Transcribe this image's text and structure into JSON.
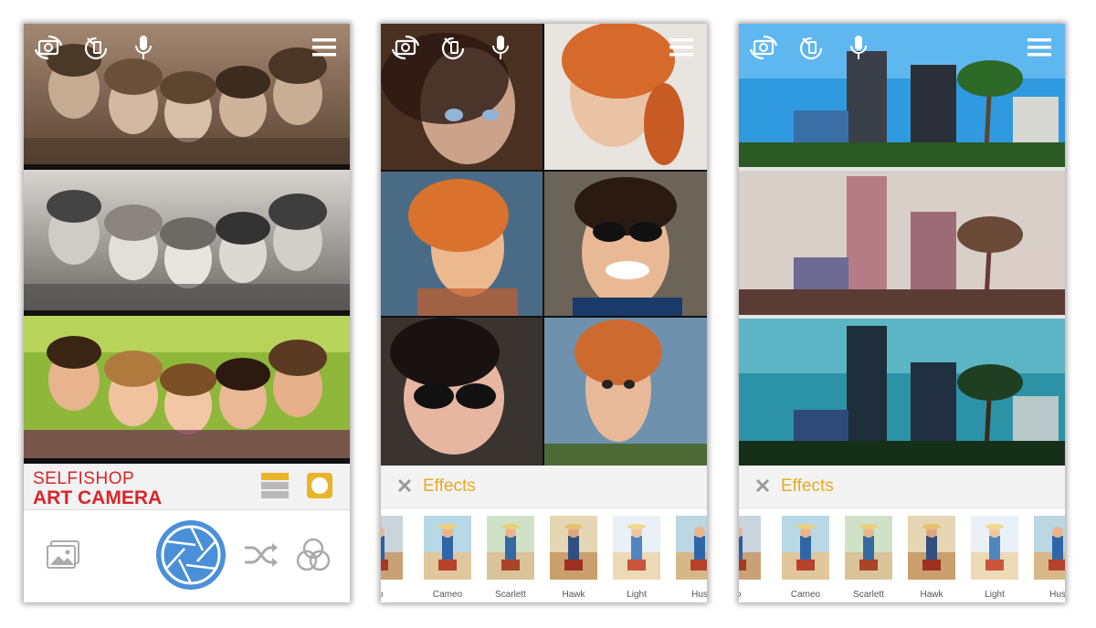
{
  "screens": [
    {
      "brand": {
        "line1": "SELFISHOP",
        "line2": "ART CAMERA"
      },
      "top_icons": [
        "switch-camera-icon",
        "timer-icon",
        "microphone-icon",
        "menu-icon"
      ],
      "controls": [
        "gallery-icon",
        "shutter-icon",
        "shuffle-icon",
        "filters-icon"
      ],
      "layout_icons": [
        "strip-layout-icon",
        "square-layout-icon"
      ]
    },
    {
      "top_icons": [
        "switch-camera-icon",
        "timer-icon",
        "microphone-icon",
        "menu-icon"
      ],
      "effects": {
        "title": "Effects",
        "items": [
          {
            "label": "ro"
          },
          {
            "label": "Cameo"
          },
          {
            "label": "Scarlett"
          },
          {
            "label": "Hawk"
          },
          {
            "label": "Light"
          },
          {
            "label": "Hus"
          }
        ]
      }
    },
    {
      "top_icons": [
        "switch-camera-icon",
        "timer-icon",
        "microphone-icon",
        "menu-icon"
      ],
      "effects": {
        "title": "Effects",
        "items": [
          {
            "label": "ro"
          },
          {
            "label": "Cameo"
          },
          {
            "label": "Scarlett"
          },
          {
            "label": "Hawk"
          },
          {
            "label": "Light"
          },
          {
            "label": "Hus"
          }
        ]
      }
    }
  ],
  "colors": {
    "brand_red": "#d9252b",
    "effects_title": "#e9a924",
    "shutter_blue": "#4a90d9",
    "layout_active": "#e9b32a"
  }
}
